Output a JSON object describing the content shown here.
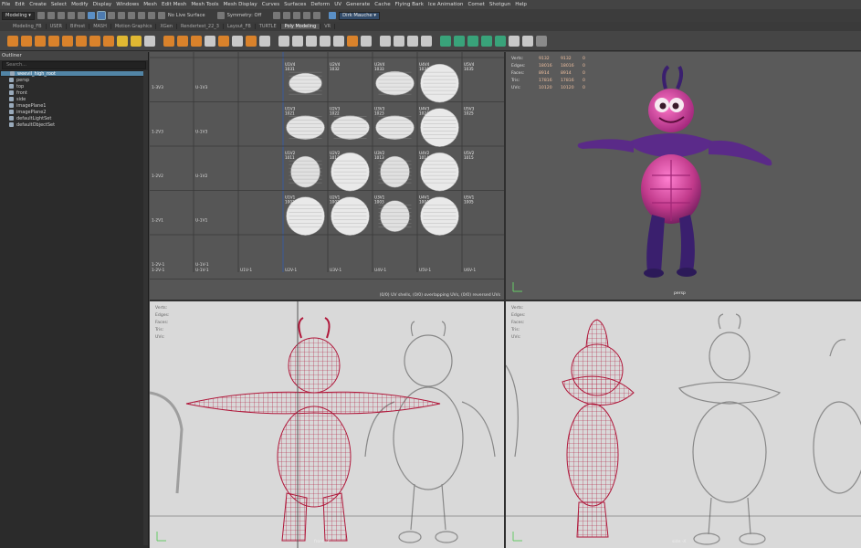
{
  "menubar": {
    "items": [
      "File",
      "Edit",
      "Create",
      "Select",
      "Modify",
      "Display",
      "Windows",
      "Mesh",
      "Edit Mesh",
      "Mesh Tools",
      "Mesh Display",
      "Curves",
      "Surfaces",
      "Deform",
      "UV",
      "Generate",
      "Cache",
      "Flying Bark",
      "Ice Animation",
      "Comet",
      "Shotgun",
      "Help"
    ]
  },
  "statusline": {
    "workspace": "Modeling",
    "live_surface": "No Live Surface",
    "symmetry": "Symmetry: Off",
    "camera": "Dirk Mauche"
  },
  "shelf_tabs": {
    "items": [
      "Modeling_FB",
      "USER",
      "Bifrost",
      "MASH",
      "Motion Graphics",
      "XGen",
      "Rendertest_22_3",
      "Layout_FB",
      "TURTLE",
      "Poly Modeling",
      "VR"
    ],
    "active": "Poly Modeling"
  },
  "outliner": {
    "title": "Outliner",
    "search_placeholder": "Search...",
    "items": [
      {
        "label": "weevil_high_root",
        "selected": true
      },
      {
        "label": "persp",
        "selected": false
      },
      {
        "label": "top",
        "selected": false
      },
      {
        "label": "front",
        "selected": false
      },
      {
        "label": "side",
        "selected": false
      },
      {
        "label": "imagePlane1",
        "selected": false
      },
      {
        "label": "imagePlane2",
        "selected": false
      },
      {
        "label": "defaultLightSet",
        "selected": false
      },
      {
        "label": "defaultObjectSet",
        "selected": false
      }
    ]
  },
  "uv_editor": {
    "row_labels": [
      "1-3V3",
      "1-2V3",
      "1-2V2",
      "1-2V1",
      "1-2V-1"
    ],
    "col_labels": [
      "U-1V3",
      "U-1V3",
      "U-1V2",
      "U-1V1",
      "U-1V-1"
    ],
    "tile_labels": [
      [
        "U1V4 1031",
        "U2V4 1032",
        "U3V4 1033",
        "U4V4 1034",
        "U5V4 1035",
        "U6V4 1036"
      ],
      [
        "U1V3 1021",
        "U2V3 1022",
        "U3V3 1023",
        "U4V3 1024",
        "U5V3 1025",
        "U6V3 1026"
      ],
      [
        "U1V2 1011",
        "U2V2 1012",
        "U3V2 1013",
        "U4V2 1014",
        "U5V2 1015",
        "U6V2 1016"
      ],
      [
        "U1V1 1001",
        "U2V1 1002",
        "U3V1 1003",
        "U4V1 1004",
        "U5V1 1005",
        "U6V1 1006"
      ]
    ],
    "bottom_labels": [
      "1-2V-1",
      "U-1V-1",
      "U1V-1",
      "U2V-1",
      "U3V-1",
      "U4V-1",
      "U5V-1",
      "U6V-1"
    ],
    "status": "(0/0) UV shells, (0/0) overlapping UVs, (0/0) reversed UVs"
  },
  "hud": {
    "rows": [
      {
        "k": "Verts:",
        "a": "9132",
        "b": "9132",
        "c": "0"
      },
      {
        "k": "Edges:",
        "a": "18016",
        "b": "18016",
        "c": "0"
      },
      {
        "k": "Faces:",
        "a": "8914",
        "b": "8914",
        "c": "0"
      },
      {
        "k": "Tris:",
        "a": "17816",
        "b": "17816",
        "c": "0"
      },
      {
        "k": "UVs:",
        "a": "10120",
        "b": "10120",
        "c": "0"
      }
    ],
    "light_rows": [
      "Verts:",
      "Edges:",
      "Faces:",
      "Tris:",
      "UVs:"
    ]
  },
  "viewports": {
    "persp_label": "persp",
    "front_label": "front -Z",
    "side_label": "side -X"
  },
  "colors": {
    "wire": "#b0173a",
    "character_body": "#c13a8b",
    "character_dark": "#3a1f6e",
    "selection": "#5285a6"
  }
}
